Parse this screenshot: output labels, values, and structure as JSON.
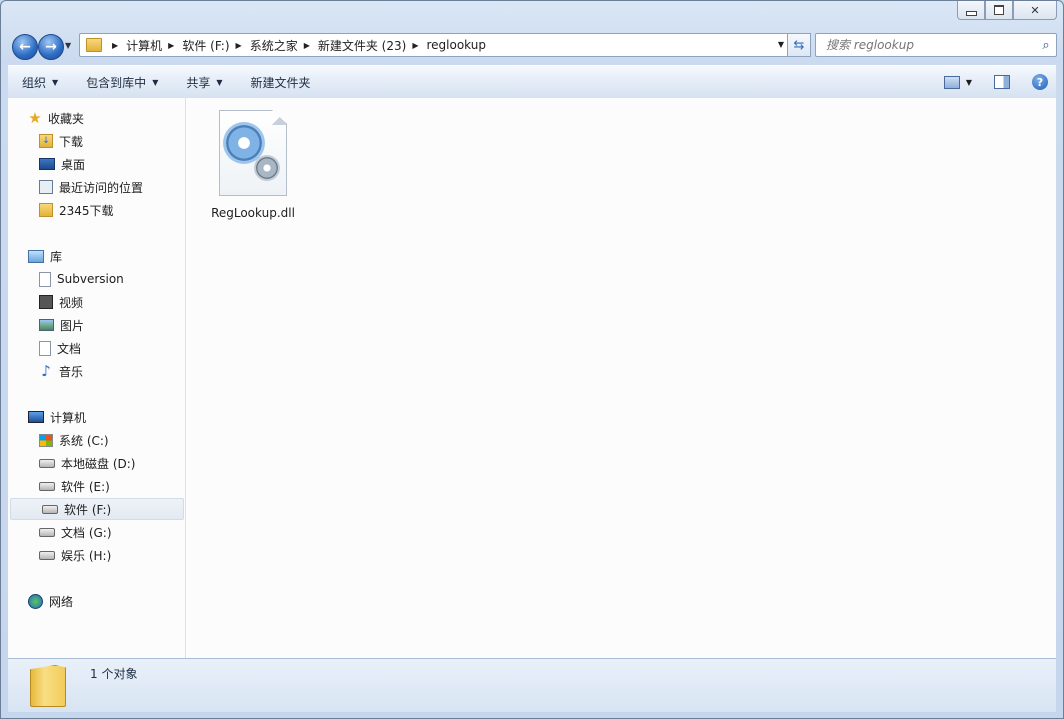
{
  "address": {
    "crumbs": [
      "计算机",
      "软件 (F:)",
      "系统之家",
      "新建文件夹 (23)",
      "reglookup"
    ]
  },
  "search": {
    "placeholder": "搜索 reglookup"
  },
  "toolbar": {
    "organize": "组织",
    "include_in_library": "包含到库中",
    "share": "共享",
    "new_folder": "新建文件夹"
  },
  "sidebar": {
    "favorites": {
      "label": "收藏夹",
      "items": [
        "下载",
        "桌面",
        "最近访问的位置",
        "2345下载"
      ]
    },
    "libraries": {
      "label": "库",
      "items": [
        "Subversion",
        "视频",
        "图片",
        "文档",
        "音乐"
      ]
    },
    "computer": {
      "label": "计算机",
      "items": [
        "系统 (C:)",
        "本地磁盘 (D:)",
        "软件 (E:)",
        "软件 (F:)",
        "文档 (G:)",
        "娱乐 (H:)"
      ],
      "selected": "软件 (F:)"
    },
    "network": {
      "label": "网络"
    }
  },
  "files": [
    {
      "name": "RegLookup.dll",
      "icon": "dll-gear-icon"
    }
  ],
  "details": {
    "count": "1 个对象"
  }
}
